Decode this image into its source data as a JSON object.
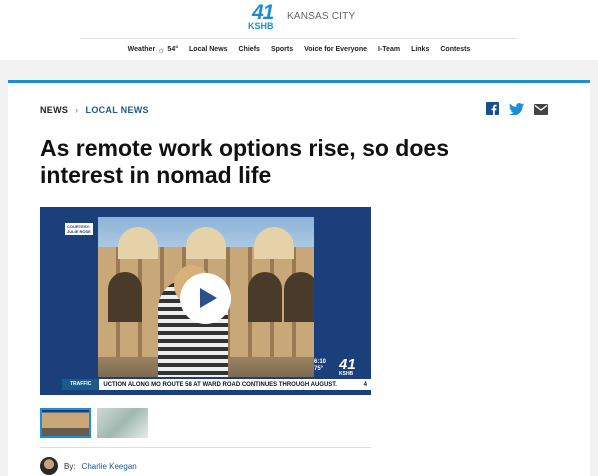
{
  "header": {
    "logo_number": "41",
    "logo_text": "KSHB",
    "city": "KANSAS CITY"
  },
  "nav": {
    "weather_label": "Weather",
    "weather_icon": "sun-icon",
    "weather_temp": "54°",
    "items": [
      "Local News",
      "Chiefs",
      "Sports",
      "Voice for Everyone",
      "I-Team",
      "Links",
      "Contests"
    ]
  },
  "breadcrumb": {
    "section": "NEWS",
    "subsection": "LOCAL NEWS"
  },
  "share": {
    "icons": [
      "facebook-icon",
      "twitter-icon",
      "email-icon"
    ],
    "colors": {
      "facebook": "#1b4f8a",
      "twitter": "#1a8fd8",
      "email": "#444444"
    }
  },
  "article": {
    "headline": "As remote work options rise, so does interest in nomad life",
    "byline_prefix": "By:",
    "author": "Charlie Keegan"
  },
  "video": {
    "courtesy_line1": "COURTESY:",
    "courtesy_line2": "JULIE ROSE",
    "bug_time": "6:10",
    "bug_temp": "75°",
    "bug_logo": "41",
    "bug_station": "KSHB",
    "ticker_label": "TRAFFIC",
    "ticker_text": "UCTION ALONG MO ROUTE 58 AT WARD ROAD CONTINUES THROUGH AUGUST.",
    "ticker_end": "4"
  },
  "theme": {
    "accent": "#1a8fd8",
    "link": "#1a5b8a"
  }
}
